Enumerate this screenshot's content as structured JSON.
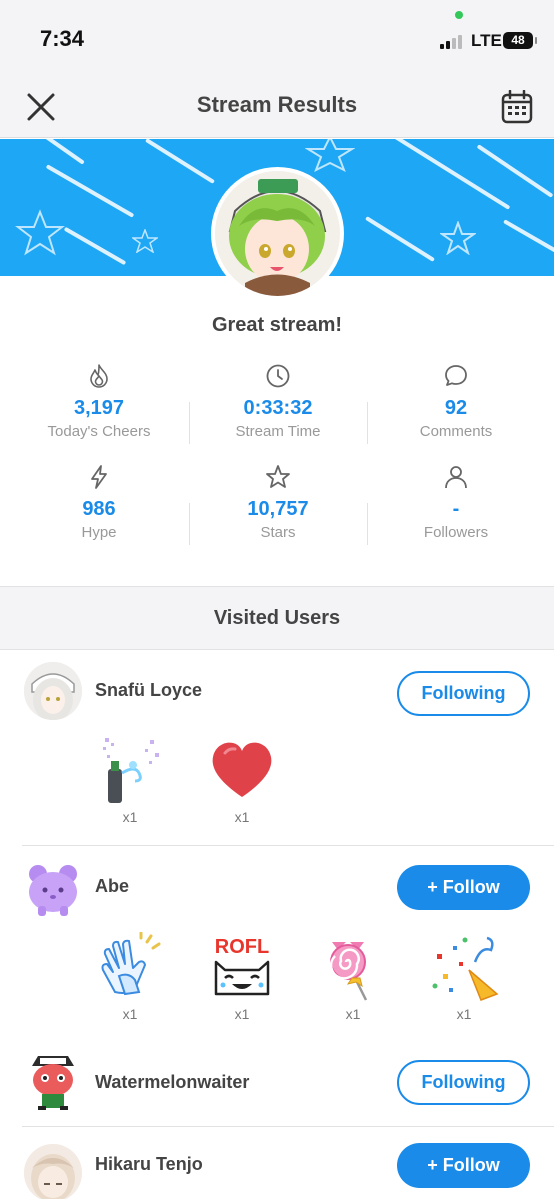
{
  "status_bar": {
    "time": "7:34",
    "network": "LTE",
    "battery": "48"
  },
  "header": {
    "title": "Stream Results"
  },
  "headline": "Great stream!",
  "stats": [
    {
      "value": "3,197",
      "label": "Today's Cheers",
      "icon": "flame-icon"
    },
    {
      "value": "0:33:32",
      "label": "Stream Time",
      "icon": "clock-icon"
    },
    {
      "value": "92",
      "label": "Comments",
      "icon": "comment-icon"
    },
    {
      "value": "986",
      "label": "Hype",
      "icon": "lightning-icon"
    },
    {
      "value": "10,757",
      "label": "Stars",
      "icon": "star-icon"
    },
    {
      "value": "-",
      "label": "Followers",
      "icon": "person-icon"
    }
  ],
  "visited": {
    "title": "Visited Users",
    "users": [
      {
        "name": "Snafü Loyce",
        "button": "Following",
        "gifts": [
          {
            "name": "bottle-sparkle-gift",
            "count": "x1"
          },
          {
            "name": "heart-gift",
            "count": "x1"
          }
        ]
      },
      {
        "name": "Abe",
        "button": "+ Follow",
        "gifts": [
          {
            "name": "clapping-hands-gift",
            "count": "x1"
          },
          {
            "name": "rofl-cat-gift",
            "count": "x1"
          },
          {
            "name": "lollipop-gift",
            "count": "x1"
          },
          {
            "name": "party-popper-gift",
            "count": "x1"
          }
        ]
      },
      {
        "name": "Watermelonwaiter",
        "button": "Following",
        "gifts": []
      },
      {
        "name": "Hikaru Tenjo",
        "button": "+ Follow",
        "gifts": []
      }
    ]
  },
  "gift_texts": {
    "rofl": "ROFL"
  },
  "colors": {
    "accent": "#1a8be8",
    "banner": "#1ea7f4",
    "page_bg": "#f4f4f6"
  }
}
